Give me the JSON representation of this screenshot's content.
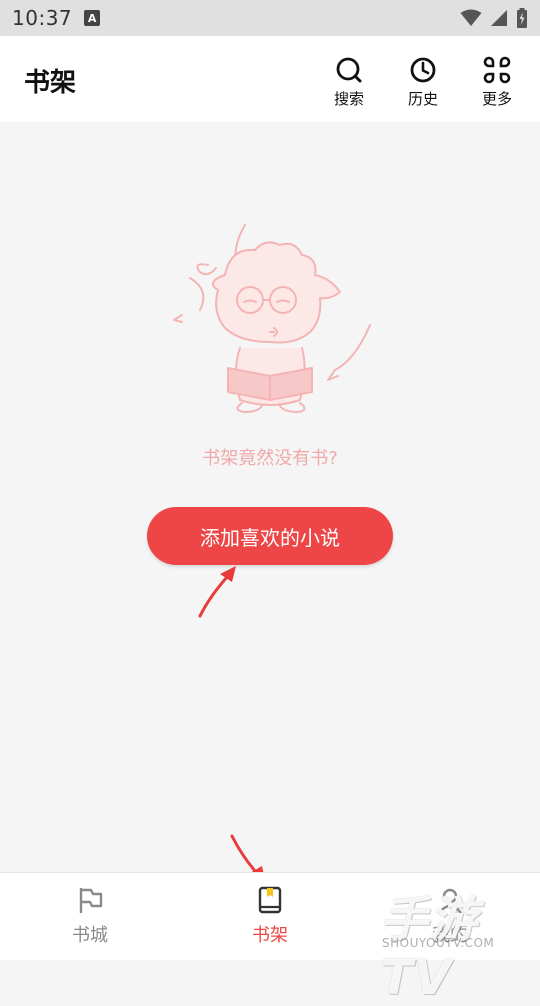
{
  "status_bar": {
    "time": "10:37",
    "notification_icon": "A"
  },
  "app_bar": {
    "title": "书架",
    "actions": [
      {
        "label": "搜索",
        "icon": "search-icon"
      },
      {
        "label": "历史",
        "icon": "history-icon"
      },
      {
        "label": "更多",
        "icon": "more-icon"
      }
    ]
  },
  "empty_state": {
    "message": "书架竟然没有书?",
    "button_label": "添加喜欢的小说"
  },
  "bottom_nav": {
    "items": [
      {
        "label": "书城",
        "icon": "flag-icon",
        "active": false
      },
      {
        "label": "书架",
        "icon": "book-icon",
        "active": true
      },
      {
        "label": "我的",
        "icon": "profile-icon",
        "active": false
      }
    ]
  },
  "watermark": {
    "brand": "手游TV",
    "url": "SHOUYOUTV.COM"
  },
  "colors": {
    "accent": "#ee4646",
    "empty_text": "#f0a9a9",
    "background": "#f5f5f5"
  }
}
